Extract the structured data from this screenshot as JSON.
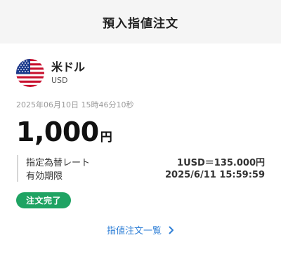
{
  "header": {
    "title": "預入指値注文"
  },
  "currency": {
    "name": "米ドル",
    "code": "USD",
    "flag_icon": "us-flag-icon"
  },
  "order": {
    "timestamp": "2025年06月10日 15時46分10秒",
    "amount": "1,000",
    "amount_unit": "円"
  },
  "details": [
    {
      "label": "指定為替レート",
      "value": "1USD＝135.000円"
    },
    {
      "label": "有効期限",
      "value": "2025/6/11 15:59:59"
    }
  ],
  "status": {
    "label": "注文完了",
    "color": "#1fa363"
  },
  "link": {
    "label": "指値注文一覧",
    "icon": "chevron-right-icon",
    "color": "#2f7fd6"
  }
}
